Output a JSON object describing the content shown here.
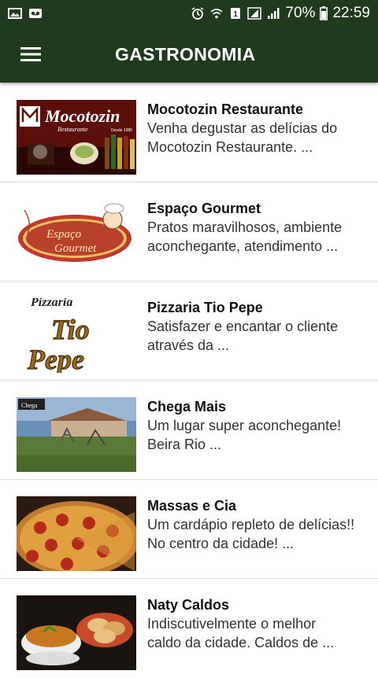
{
  "status_bar": {
    "battery": "70%",
    "time": "22:59"
  },
  "app_bar": {
    "title": "GASTRONOMIA"
  },
  "items": [
    {
      "name": "Mocotozin Restaurante",
      "desc1": "Venha degustar as delícias do",
      "desc2": "Mocotozin Restaurante. ...",
      "logo_text": "Mocotozin",
      "logo_sub": "Restaurante",
      "logo_since": "Desde 1985"
    },
    {
      "name": "Espaço Gourmet",
      "desc1": "Pratos maravilhosos, ambiente",
      "desc2": "aconchegante, atendimento ...",
      "logo_text1": "Espaço",
      "logo_text2": "Gourmet"
    },
    {
      "name": "Pizzaria Tio Pepe",
      "desc1": "Satisfazer  e encantar o cliente",
      "desc2": "através da ...",
      "logo_top": "Pizzaria",
      "logo_a": "Tio",
      "logo_b": "Pepe"
    },
    {
      "name": "Chega Mais",
      "desc1": "Um lugar super aconchegante!",
      "desc2": "Beira Rio ...",
      "logo_text": "Chega"
    },
    {
      "name": "Massas e Cia",
      "desc1": "Um cardápio repleto de delícias!!",
      "desc2": "No centro da cidade! ..."
    },
    {
      "name": "Naty Caldos",
      "desc1": "Indiscutivelmente o melhor",
      "desc2": "caldo da cidade. Caldos de ..."
    }
  ],
  "colors": {
    "bar": "#1f3a1c",
    "divider": "#d9d9d9"
  }
}
